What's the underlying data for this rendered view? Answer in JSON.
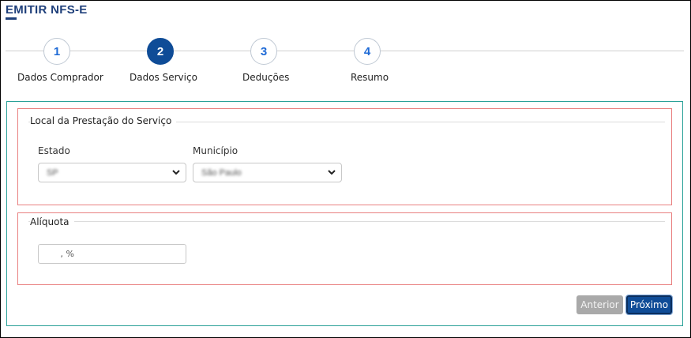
{
  "header": {
    "title": "EMITIR NFS-E"
  },
  "stepper": {
    "steps": [
      {
        "number": "1",
        "label": "Dados Comprador",
        "active": false
      },
      {
        "number": "2",
        "label": "Dados Serviço",
        "active": true
      },
      {
        "number": "3",
        "label": "Deduções",
        "active": false
      },
      {
        "number": "4",
        "label": "Resumo",
        "active": false
      }
    ]
  },
  "local_prestacao": {
    "legend": "Local da Prestação do Serviço",
    "estado": {
      "label": "Estado",
      "value": "SP"
    },
    "municipio": {
      "label": "Município",
      "value": "São Paulo"
    }
  },
  "aliquota": {
    "legend": "Alíquota",
    "value": " , %"
  },
  "actions": {
    "previous_label": "Anterior",
    "next_label": "Próximo"
  },
  "icons": {
    "select_caret": "chevron-down-icon"
  },
  "colors": {
    "primary": "#0f4c97",
    "card_border": "#2aa198",
    "fieldset_border": "#e98181"
  }
}
